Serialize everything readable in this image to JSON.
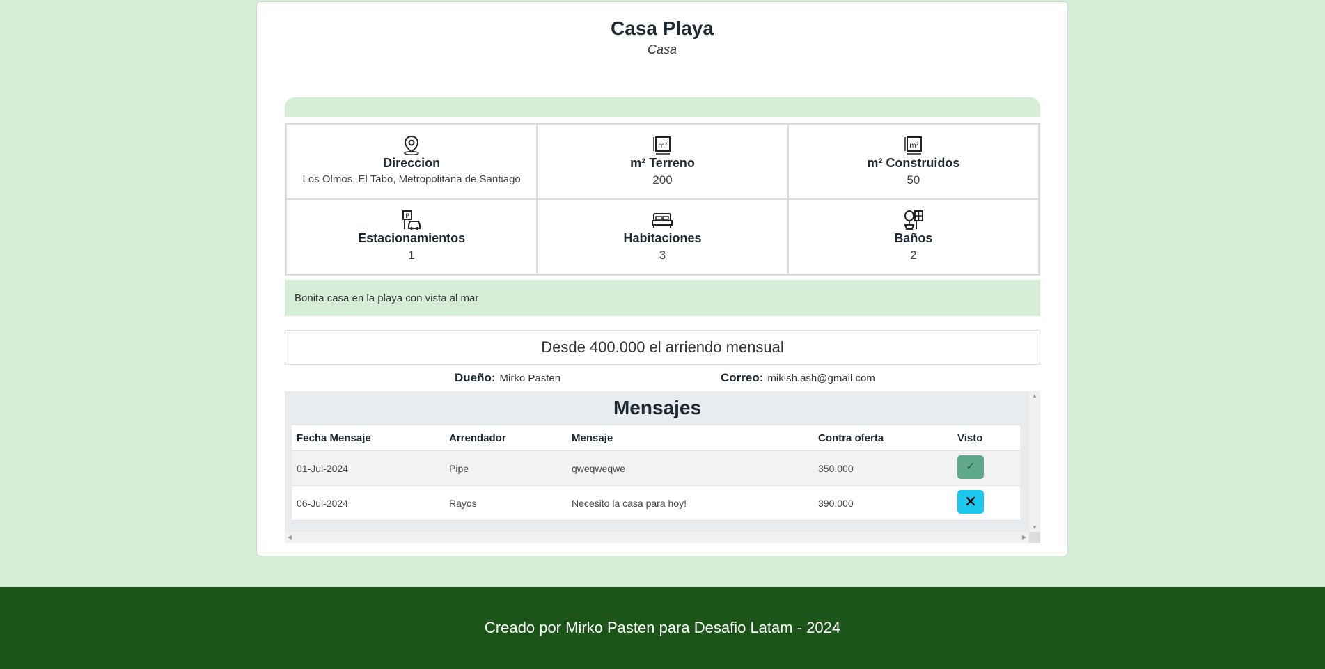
{
  "property": {
    "name": "Casa Playa",
    "type": "Casa"
  },
  "features": [
    {
      "icon": "location-pin-icon",
      "label": "Direccion",
      "value": "Los Olmos, El Tabo, Metropolitana de Santiago"
    },
    {
      "icon": "land-area-icon",
      "label": "m² Terreno",
      "value": "200"
    },
    {
      "icon": "built-area-icon",
      "label": "m² Construidos",
      "value": "50"
    },
    {
      "icon": "parking-icon",
      "label": "Estacionamientos",
      "value": "1"
    },
    {
      "icon": "bed-icon",
      "label": "Habitaciones",
      "value": "3"
    },
    {
      "icon": "bathroom-icon",
      "label": "Baños",
      "value": "2"
    }
  ],
  "description": "Bonita casa en la playa con vista al mar",
  "price": "Desde 400.000 el arriendo mensual",
  "owner": {
    "label": "Dueño:",
    "name": "Mirko Pasten",
    "email_label": "Correo:",
    "email": "mikish.ash@gmail.com"
  },
  "messages": {
    "title": "Mensajes",
    "headers": [
      "Fecha Mensaje",
      "Arrendador",
      "Mensaje",
      "Contra oferta",
      "Visto"
    ],
    "rows": [
      {
        "date": "01-Jul-2024",
        "tenant": "Pipe",
        "message": "qweqweqwe",
        "offer": "350.000",
        "seen": "check-icon"
      },
      {
        "date": "06-Jul-2024",
        "tenant": "Rayos",
        "message": "Necesito la casa para hoy!",
        "offer": "390.000",
        "seen": "x-icon"
      }
    ]
  },
  "colors": {
    "page_bg": "#d6eed8",
    "footer_bg": "#1c5419",
    "seen_button": "#5fa88b",
    "unseen_button": "#1cc8ee"
  },
  "footer": "Creado por Mirko Pasten para Desafio Latam - 2024"
}
